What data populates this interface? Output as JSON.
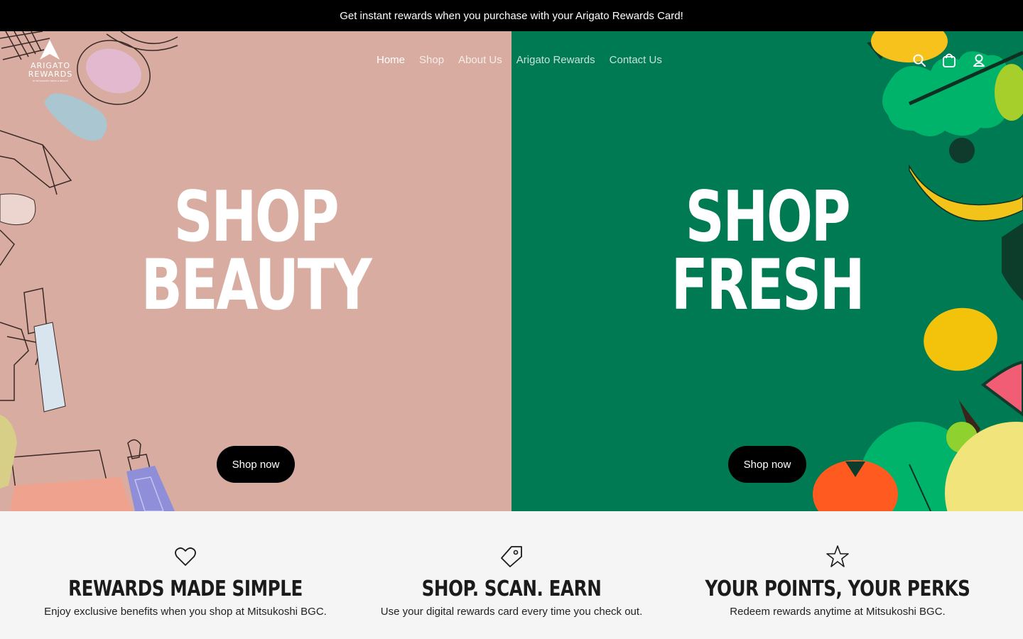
{
  "announcement": {
    "text": "Get instant rewards when you purchase with your Arigato Rewards Card!"
  },
  "header": {
    "logo": {
      "line1": "ARIGATO",
      "line2": "REWARDS",
      "tagline": "BY MITSUKOSHI FRESH & BEAUTY"
    },
    "nav": [
      {
        "label": "Home",
        "active": true
      },
      {
        "label": "Shop"
      },
      {
        "label": "About Us"
      },
      {
        "label": "Arigato Rewards"
      },
      {
        "label": "Contact Us"
      }
    ],
    "icons": [
      "search-icon",
      "cart-icon",
      "account-icon"
    ]
  },
  "hero": {
    "beauty": {
      "line1": "SHOP",
      "line2": "BEAUTY",
      "button": "Shop now",
      "background": "#d8aca0"
    },
    "fresh": {
      "line1": "SHOP",
      "line2": "FRESH",
      "button": "Shop now",
      "background": "#007a52"
    }
  },
  "features": [
    {
      "icon": "heart-icon",
      "title": "REWARDS MADE SIMPLE",
      "text": "Enjoy exclusive benefits when you shop at Mitsukoshi BGC."
    },
    {
      "icon": "tag-icon",
      "title": "SHOP. SCAN. EARN",
      "text": "Use your digital rewards card every time you check out."
    },
    {
      "icon": "star-icon",
      "title": "YOUR POINTS, YOUR PERKS",
      "text": "Redeem rewards anytime at Mitsukoshi BGC."
    }
  ]
}
